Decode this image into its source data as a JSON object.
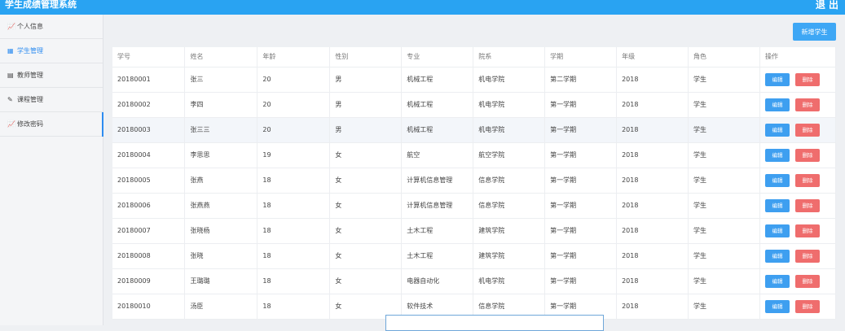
{
  "app": {
    "title": "学生成绩管理系统",
    "logout": "退 出"
  },
  "sidebar": {
    "items": [
      {
        "icon": "📈",
        "label": "个人信息"
      },
      {
        "icon": "▦",
        "label": "学生管理"
      },
      {
        "icon": "▤",
        "label": "教师管理"
      },
      {
        "icon": "✎",
        "label": "课程管理"
      },
      {
        "icon": "📈",
        "label": "修改密码"
      }
    ]
  },
  "toolbar": {
    "add_label": "新增学生"
  },
  "table": {
    "headers": [
      "学号",
      "姓名",
      "年龄",
      "性别",
      "专业",
      "院系",
      "学期",
      "年级",
      "角色",
      "操作"
    ],
    "edit_label": "编辑",
    "delete_label": "删除",
    "rows": [
      [
        "20180001",
        "张三",
        "20",
        "男",
        "机械工程",
        "机电学院",
        "第二学期",
        "2018",
        "学生"
      ],
      [
        "20180002",
        "李四",
        "20",
        "男",
        "机械工程",
        "机电学院",
        "第一学期",
        "2018",
        "学生"
      ],
      [
        "20180003",
        "张三三",
        "20",
        "男",
        "机械工程",
        "机电学院",
        "第一学期",
        "2018",
        "学生"
      ],
      [
        "20180004",
        "李思思",
        "19",
        "女",
        "航空",
        "航空学院",
        "第一学期",
        "2018",
        "学生"
      ],
      [
        "20180005",
        "张燕",
        "18",
        "女",
        "计算机信息管理",
        "信息学院",
        "第一学期",
        "2018",
        "学生"
      ],
      [
        "20180006",
        "张燕燕",
        "18",
        "女",
        "计算机信息管理",
        "信息学院",
        "第一学期",
        "2018",
        "学生"
      ],
      [
        "20180007",
        "张晓杨",
        "18",
        "女",
        "土木工程",
        "建筑学院",
        "第一学期",
        "2018",
        "学生"
      ],
      [
        "20180008",
        "张晓",
        "18",
        "女",
        "土木工程",
        "建筑学院",
        "第一学期",
        "2018",
        "学生"
      ],
      [
        "20180009",
        "王璐璐",
        "18",
        "女",
        "电器自动化",
        "机电学院",
        "第一学期",
        "2018",
        "学生"
      ],
      [
        "20180010",
        "汤臣",
        "18",
        "女",
        "软件技术",
        "信息学院",
        "第一学期",
        "2018",
        "学生"
      ]
    ]
  },
  "colors": {
    "topbar": "#29a3f2",
    "accent": "#2d8cf0",
    "edit": "#3e9ff0",
    "delete": "#ef6d6d"
  }
}
